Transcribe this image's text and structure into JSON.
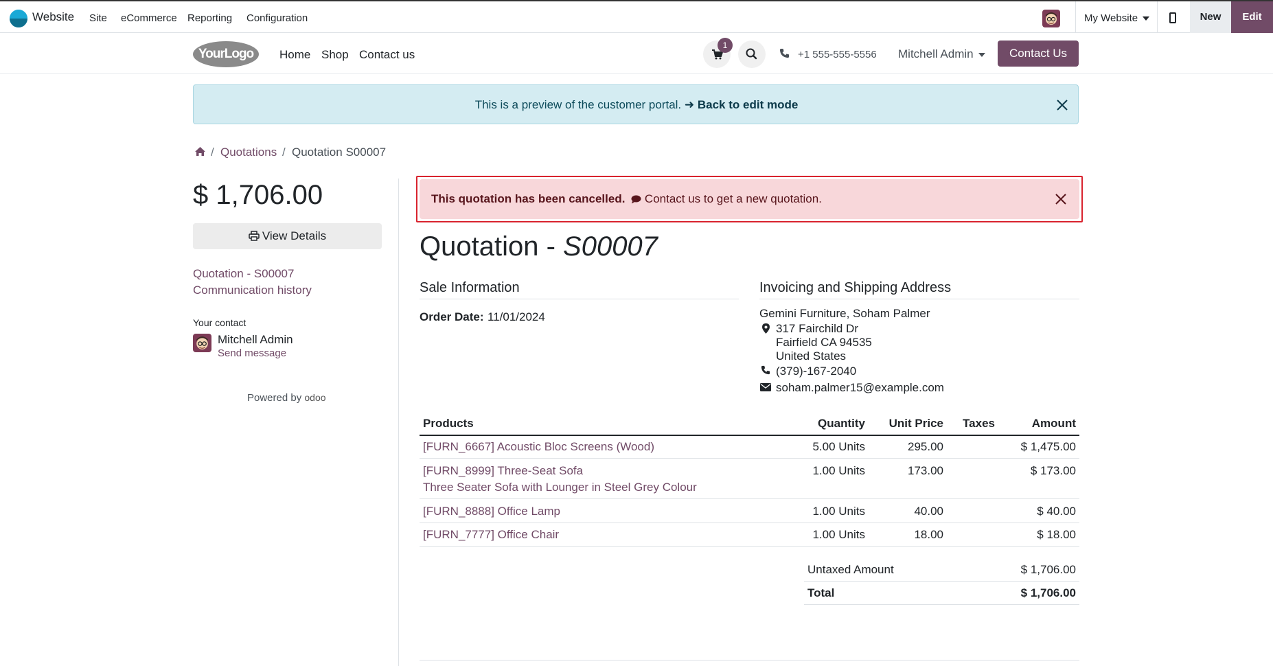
{
  "admin_bar": {
    "app_name": "Website",
    "menu": [
      "Site",
      "eCommerce",
      "Reporting",
      "Configuration"
    ],
    "site_selector": "My Website",
    "new_label": "New",
    "edit_label": "Edit"
  },
  "site_header": {
    "logo_text": "YourLogo",
    "nav": [
      "Home",
      "Shop",
      "Contact us"
    ],
    "cart_count": "1",
    "phone": "+1 555-555-5556",
    "user": "Mitchell Admin",
    "contact_button": "Contact Us"
  },
  "preview_banner": {
    "text": "This is a preview of the customer portal.",
    "link": "Back to edit mode"
  },
  "breadcrumb": {
    "items": [
      "Quotations",
      "Quotation S00007"
    ]
  },
  "sidebar": {
    "total": "$ 1,706.00",
    "view_details": "View Details",
    "links": [
      "Quotation - S00007",
      "Communication history"
    ],
    "contact_label": "Your contact",
    "contact_name": "Mitchell Admin",
    "send_message": "Send message",
    "powered_by": "Powered by",
    "powered_brand": "odoo"
  },
  "alert": {
    "bold": "This quotation has been cancelled.",
    "text": "Contact us to get a new quotation."
  },
  "quotation": {
    "title_prefix": "Quotation - ",
    "number": "S00007",
    "sale_info_title": "Sale Information",
    "order_date_label": "Order Date:",
    "order_date": "11/01/2024",
    "address_title": "Invoicing and Shipping Address",
    "customer": "Gemini Furniture, Soham Palmer",
    "street": "317 Fairchild Dr",
    "city": "Fairfield CA 94535",
    "country": "United States",
    "phone": "(379)-167-2040",
    "email": "soham.palmer15@example.com"
  },
  "table": {
    "headers": [
      "Products",
      "Quantity",
      "Unit Price",
      "Taxes",
      "Amount"
    ],
    "rows": [
      {
        "product": "[FURN_6667] Acoustic Bloc Screens (Wood)",
        "desc": "",
        "qty": "5.00 Units",
        "price": "295.00",
        "taxes": "",
        "amount": "$ 1,475.00"
      },
      {
        "product": "[FURN_8999] Three-Seat Sofa",
        "desc": "Three Seater Sofa with Lounger in Steel Grey Colour",
        "qty": "1.00 Units",
        "price": "173.00",
        "taxes": "",
        "amount": "$ 173.00"
      },
      {
        "product": "[FURN_8888] Office Lamp",
        "desc": "",
        "qty": "1.00 Units",
        "price": "40.00",
        "taxes": "",
        "amount": "$ 40.00"
      },
      {
        "product": "[FURN_7777] Office Chair",
        "desc": "",
        "qty": "1.00 Units",
        "price": "18.00",
        "taxes": "",
        "amount": "$ 18.00"
      }
    ],
    "untaxed_label": "Untaxed Amount",
    "untaxed": "$ 1,706.00",
    "total_label": "Total",
    "total": "$ 1,706.00"
  },
  "colors": {
    "brand": "#714b67",
    "alert_bg": "#f8d7da",
    "alert_outline": "#d9232e",
    "preview_bg": "#d4ecf2"
  },
  "icons": [
    "home-icon",
    "cart-icon",
    "search-icon",
    "phone-icon",
    "close-icon",
    "print-icon",
    "comment-icon",
    "map-marker-icon",
    "envelope-icon",
    "mobile-icon"
  ]
}
